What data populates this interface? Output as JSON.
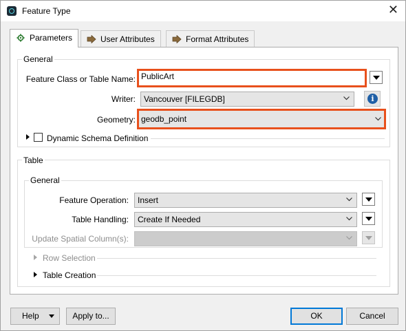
{
  "window": {
    "title": "Feature Type",
    "close_glyph": "✕"
  },
  "tabs": [
    {
      "label": "Parameters",
      "icon": "gear-icon",
      "active": true
    },
    {
      "label": "User Attributes",
      "icon": "arrow-right-icon",
      "active": false
    },
    {
      "label": "Format Attributes",
      "icon": "arrow-right-icon",
      "active": false
    }
  ],
  "general": {
    "label": "General",
    "feature_class_label": "Feature Class or Table Name:",
    "feature_class_value": "PublicArt",
    "writer_label": "Writer:",
    "writer_value": "Vancouver [FILEGDB]",
    "info_glyph": "i",
    "geometry_label": "Geometry:",
    "geometry_value": "geodb_point",
    "dynamic_schema_label": "Dynamic Schema Definition",
    "dynamic_schema_checked": false
  },
  "table": {
    "label": "Table",
    "general_label": "General",
    "feature_operation_label": "Feature Operation:",
    "feature_operation_value": "Insert",
    "table_handling_label": "Table Handling:",
    "table_handling_value": "Create If Needed",
    "update_spatial_label": "Update Spatial Column(s):",
    "update_spatial_value": "",
    "row_selection_label": "Row Selection",
    "table_creation_label": "Table Creation"
  },
  "footer": {
    "help_label": "Help",
    "apply_label": "Apply to...",
    "ok_label": "OK",
    "cancel_label": "Cancel"
  },
  "colors": {
    "highlight": "#e8501c",
    "accent": "#0078d7",
    "info": "#1f5fa6"
  }
}
